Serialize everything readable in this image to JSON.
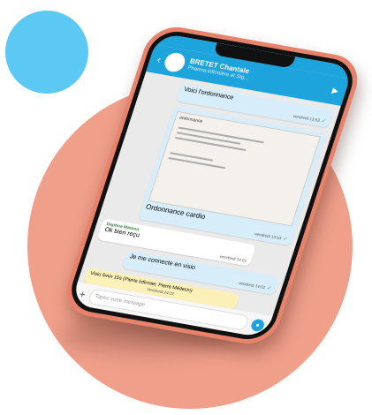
{
  "colors": {
    "accent": "#1ea4dc",
    "blue_circle": "#5cc8f4",
    "salmon_circle": "#ef9f8a",
    "phone_body": "#e8836b"
  },
  "header": {
    "name": "BRETET Chantale",
    "role": "Pharma infirmière et Stg..."
  },
  "messages": [
    {
      "text": "Voici l'ordonnance",
      "time": "vendredi 13:53",
      "direction": "out"
    },
    {
      "doc_title": "ordonnance",
      "text": "Ordonnance cardio",
      "time": "vendredi 13:53",
      "direction": "out"
    },
    {
      "sender": "Daphne Matson",
      "text": "Ok bien reçu",
      "time": "vendredi 14:01",
      "direction": "in"
    },
    {
      "text": "Je me connecte en visio",
      "time": "vendredi 14:01",
      "direction": "out"
    },
    {
      "text": "Visio 5min 15s (Pierre Infirmier, Pierre Médecin)",
      "time": "Vendredi 14:02",
      "direction": "in-yellow"
    }
  ],
  "input": {
    "placeholder": "Tapez votre message"
  },
  "icons": {
    "back": "back-arrow-icon",
    "video": "video-camera-icon",
    "add": "plus-icon",
    "send_camera": "camera-icon"
  }
}
